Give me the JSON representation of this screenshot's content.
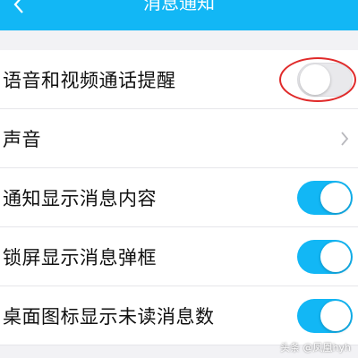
{
  "header": {
    "title": "消息通知",
    "back_icon": "chevron-left-icon"
  },
  "colors": {
    "accent": "#12b7f5",
    "annotation": "#e02a2a"
  },
  "settings": [
    {
      "label": "语音和视频通话提醒",
      "control": "toggle",
      "on": false,
      "highlighted": true
    },
    {
      "label": "声音",
      "control": "chevron-right-icon"
    },
    {
      "label": "通知显示消息内容",
      "control": "toggle",
      "on": true
    },
    {
      "label": "锁屏显示消息弹框",
      "control": "toggle",
      "on": true
    },
    {
      "label": "桌面图标显示未读消息数",
      "control": "toggle",
      "on": true
    }
  ],
  "watermark": "头条 @凤凰hyh"
}
